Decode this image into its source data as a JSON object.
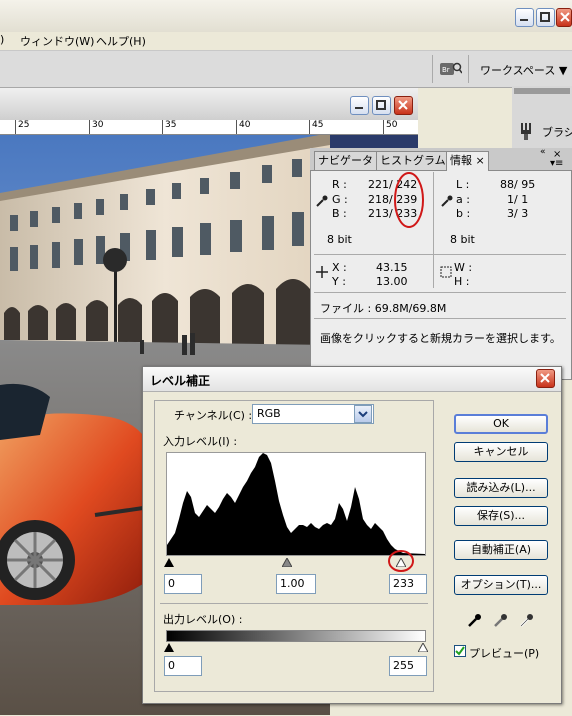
{
  "menubar": {
    "items": [
      "ウィンドウ(W)",
      "ヘルプ(H)"
    ]
  },
  "toolbar": {
    "workspace_label": "ワークスペース ▼"
  },
  "document": {
    "ruler_labels": [
      "25",
      "30",
      "35",
      "40",
      "45",
      "50"
    ]
  },
  "dock": {
    "brush_label": "ブラシ"
  },
  "info_panel": {
    "tabs": [
      "ナビゲータ",
      "ヒストグラム",
      "情報"
    ],
    "rgb": {
      "r_label": "R :",
      "r_value": "221/ 242",
      "g_label": "G :",
      "g_value": "218/ 239",
      "b_label": "B :",
      "b_value": "213/ 233"
    },
    "lab": {
      "l_label": "L :",
      "l_value": "88/  95",
      "a_label": "a :",
      "a_value": "1/   1",
      "b_label": "b :",
      "b_value": "3/   3"
    },
    "bit_left": "8 bit",
    "bit_right": "8 bit",
    "x_label": "X :",
    "x_value": "43.15",
    "y_label": "Y :",
    "y_value": "13.00",
    "w_label": "W :",
    "h_label": "H :",
    "file_info": "ファイル : 69.8M/69.8M",
    "hint": "画像をクリックすると新規カラーを選択します。"
  },
  "levels_dialog": {
    "title": "レベル補正",
    "channel_label": "チャンネル(C) :",
    "channel_value": "RGB",
    "input_label": "入力レベル(I) :",
    "input_black": "0",
    "input_gamma": "1.00",
    "input_white": "233",
    "output_label": "出力レベル(O) :",
    "output_black": "0",
    "output_white": "255",
    "buttons": {
      "ok": "OK",
      "cancel": "キャンセル",
      "load": "読み込み(L)...",
      "save": "保存(S)...",
      "auto": "自動補正(A)",
      "options": "オプション(T)..."
    },
    "preview_label": "プレビュー(P)",
    "preview_checked": true
  },
  "colors": {
    "close_red": "#c8321a",
    "highlight_circle": "#d01818",
    "sky": "#6f95cf",
    "building": "#e7dccb"
  }
}
